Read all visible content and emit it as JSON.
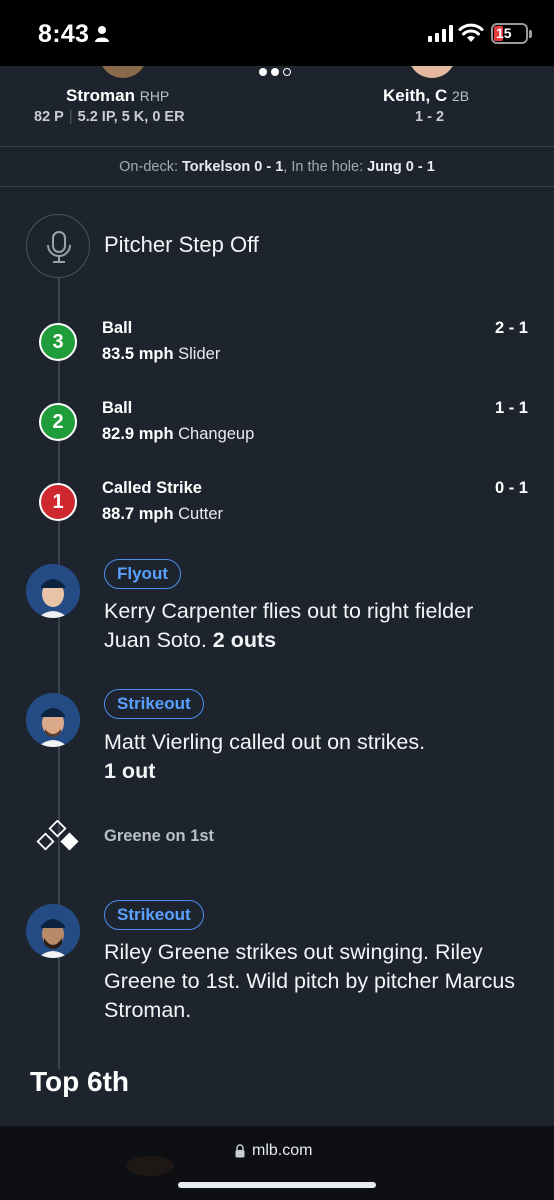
{
  "status_bar": {
    "time": "8:43",
    "battery": "15"
  },
  "matchup": {
    "pitcher": {
      "name": "Stroman",
      "position": "RHP",
      "pitches": "82 P",
      "line": "5.2 IP, 5 K, 0 ER"
    },
    "batter": {
      "name": "Keith, C",
      "position": "2B",
      "line": "1 - 2"
    },
    "pager_active_index": 1
  },
  "on_deck": {
    "on_deck_label": "On-deck:",
    "on_deck_value": "Torkelson 0 - 1",
    "hole_label": "In the hole:",
    "hole_value": "Jung 0 - 1"
  },
  "feed": {
    "event_title": "Pitcher Step Off",
    "pitches": [
      {
        "number": "3",
        "result": "Ball",
        "speed": "83.5 mph",
        "type": "Slider",
        "count": "2 - 1",
        "color": "#1f9d3a"
      },
      {
        "number": "2",
        "result": "Ball",
        "speed": "82.9 mph",
        "type": "Changeup",
        "count": "1 - 1",
        "color": "#1f9d3a"
      },
      {
        "number": "1",
        "result": "Called Strike",
        "speed": "88.7 mph",
        "type": "Cutter",
        "count": "0 - 1",
        "color": "#d0282f"
      }
    ],
    "plays": [
      {
        "badge": "Flyout",
        "text": "Kerry Carpenter flies out to right fielder Juan Soto.",
        "outs": "2 outs"
      },
      {
        "badge": "Strikeout",
        "text": "Matt Vierling called out on strikes.",
        "outs": "1 out"
      },
      {
        "badge": "Strikeout",
        "text": "Riley Greene strikes out swinging. Riley Greene to 1st. Wild pitch by pitcher Marcus Stroman.",
        "outs": ""
      }
    ],
    "runner": "Greene on 1st",
    "inning_header": "Top 6th"
  },
  "browser": {
    "url": "mlb.com"
  },
  "colors": {
    "background": "#1e242d",
    "ball": "#1f9d3a",
    "strike": "#d0282f",
    "badge": "#4a8ff0"
  }
}
